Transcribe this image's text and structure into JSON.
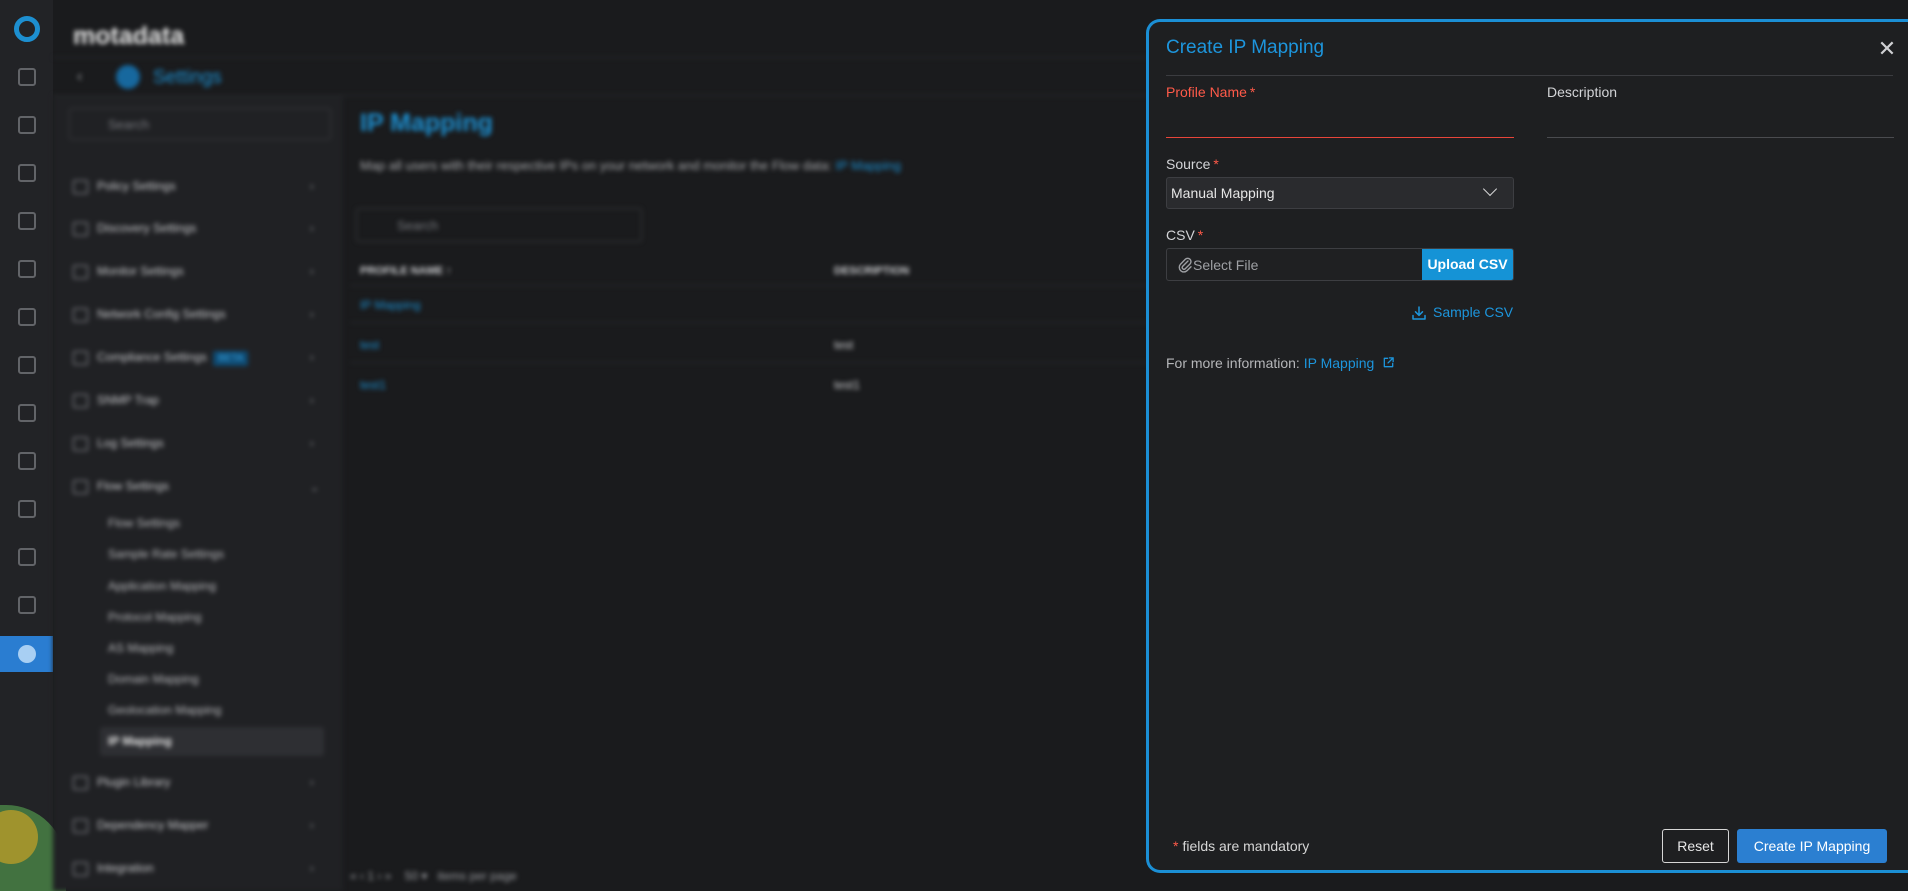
{
  "app": {
    "brand": "motadata"
  },
  "breadcrumb": {
    "title": "Settings"
  },
  "sidebar": {
    "search_placeholder": "Search",
    "items": [
      {
        "label": "Policy Settings",
        "icon": "policy-icon"
      },
      {
        "label": "Discovery Settings",
        "icon": "discovery-icon"
      },
      {
        "label": "Monitor Settings",
        "icon": "monitor-icon"
      },
      {
        "label": "Network Config Settings",
        "icon": "network-config-icon"
      },
      {
        "label": "Compliance Settings",
        "icon": "compliance-icon",
        "badge": "BETA"
      },
      {
        "label": "SNMP Trap",
        "icon": "snmp-icon"
      },
      {
        "label": "Log Settings",
        "icon": "log-icon"
      },
      {
        "label": "Flow Settings",
        "icon": "flow-icon"
      },
      {
        "label": "Plugin Library",
        "icon": "plugin-icon"
      },
      {
        "label": "Dependency Mapper",
        "icon": "dependency-icon"
      },
      {
        "label": "Integration",
        "icon": "integration-icon"
      }
    ],
    "flow_sub_items": [
      "Flow Settings",
      "Sample Rate Settings",
      "Application Mapping",
      "Protocol Mapping",
      "AS Mapping",
      "Domain Mapping",
      "Geolocation Mapping",
      "IP Mapping"
    ]
  },
  "page": {
    "title": "IP Mapping",
    "description": "Map all users with their respective IPs on your network and monitor the Flow data:",
    "description_link": "IP Mapping",
    "search_placeholder": "Search",
    "columns": [
      "PROFILE NAME ↑",
      "DESCRIPTION"
    ],
    "rows": [
      {
        "name": "IP Mapping",
        "description": ""
      },
      {
        "name": "test",
        "description": "test"
      },
      {
        "name": "test1",
        "description": "test1"
      }
    ],
    "pagination": {
      "page": "1",
      "per_page": "50",
      "per_page_label": "items per page"
    }
  },
  "drawer": {
    "title": "Create IP Mapping",
    "profile_name_label": "Profile Name",
    "profile_name_value": "",
    "description_label": "Description",
    "description_value": "",
    "source_label": "Source",
    "source_value": "Manual Mapping",
    "csv_label": "CSV",
    "file_placeholder": "Select File",
    "upload_label": "Upload CSV",
    "sample_csv_label": "Sample CSV",
    "info_text": "For more information:",
    "info_link": "IP Mapping",
    "mandatory_note": "fields are mandatory",
    "required_mark": "*",
    "reset_label": "Reset",
    "create_label": "Create IP Mapping"
  },
  "colors": {
    "accent": "#1d95dc",
    "error": "#ff5a49",
    "primary_button": "#2b7fd1",
    "background": "#1a1b1d"
  }
}
